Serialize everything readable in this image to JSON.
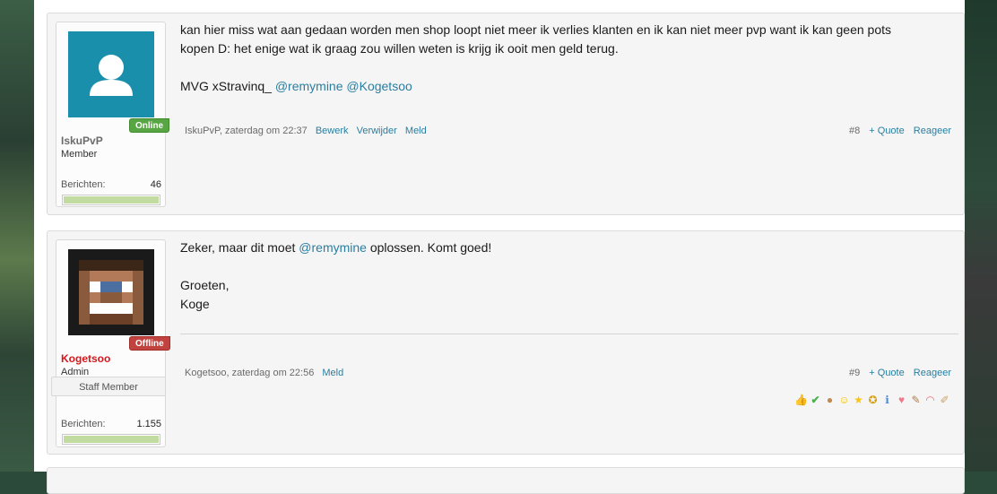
{
  "posts": [
    {
      "user": {
        "name": "IskuPvP",
        "title": "Member",
        "status": "Online",
        "stat_label": "Berichten:",
        "stat_value": "46",
        "stat_fill": 1.0
      },
      "message": {
        "line1": "kan hier miss wat aan gedaan worden men shop loopt niet meer ik verlies klanten en ik kan niet meer pvp want ik kan geen pots",
        "line2": "kopen D: het enige wat ik graag zou willen weten is krijg ik ooit men geld terug.",
        "sig_prefix": "MVG xStravinq_ ",
        "mention1": "@remymine",
        "mention2": "@Kogetsoo"
      },
      "meta": {
        "author_time": "IskuPvP, zaterdag om 22:37",
        "actions": [
          "Bewerk",
          "Verwijder",
          "Meld"
        ],
        "post_no": "#8",
        "quote": "+ Quote",
        "reply": "Reageer"
      }
    },
    {
      "user": {
        "name": "Kogetsoo",
        "title": "Admin",
        "status": "Offline",
        "banner": "Staff Member",
        "stat_label": "Berichten:",
        "stat_value": "1.155",
        "stat_fill": 1.0
      },
      "message": {
        "prefix": "Zeker, maar dit moet ",
        "mention": "@remymine",
        "suffix": " oplossen. Komt goed!",
        "greeting": "Groeten,",
        "name": "Koge"
      },
      "meta": {
        "author_time": "Kogetsoo, zaterdag om 22:56",
        "actions": [
          "Meld"
        ],
        "post_no": "#9",
        "quote": "+ Quote",
        "reply": "Reageer"
      },
      "reactions": [
        "thumbs-up",
        "check",
        "cookie",
        "smile",
        "star",
        "medal",
        "info",
        "heart",
        "wrench",
        "rainbow",
        "brush"
      ]
    }
  ],
  "colors": {
    "link": "#2a7ea0",
    "online": "#58a544",
    "offline": "#c0433f",
    "admin_name": "#d8161b",
    "avatar_bg": "#1a8fac"
  }
}
